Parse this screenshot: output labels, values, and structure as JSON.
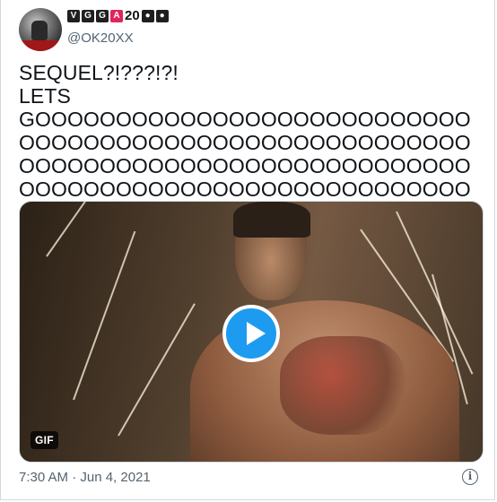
{
  "author": {
    "display_name_parts": [
      "V",
      "G",
      "G",
      "A",
      "20",
      "●",
      "●"
    ],
    "handle": "@OK20XX"
  },
  "tweet": {
    "text": "SEQUEL?!???!?!\nLETS\nGOOOOOOOOOOOOOOOOOOOOOOOOOOOOOOOOOOOOOOOOOOOOOOOOOOOOOOOOOOOOOOOOOOOOOOOOOOOOOOOOOOOOOOOOOOOOOOOOOOOOOOOOOOOOOOOOOOOOOOOOOOOOOOOOOOO"
  },
  "media": {
    "badge": "GIF",
    "play_icon": "play-icon"
  },
  "meta": {
    "timestamp": "7:30 AM · Jun 4, 2021",
    "info_icon": "info-icon"
  },
  "colors": {
    "accent": "#1d9bf0",
    "text": "#0f1419",
    "muted": "#536471",
    "brand_red": "#e0245e"
  }
}
